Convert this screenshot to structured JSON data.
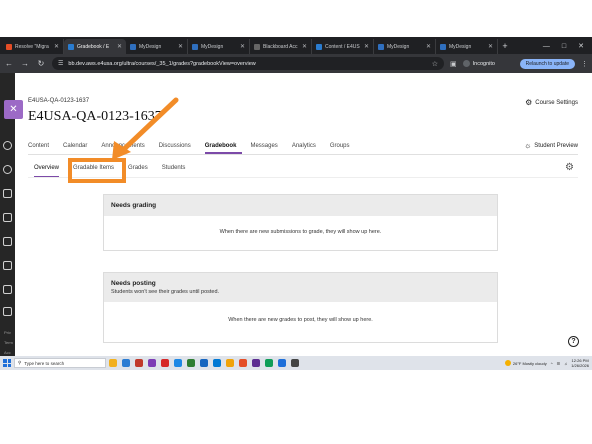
{
  "browser": {
    "tabs": [
      {
        "title": "Resolve \"Migra",
        "favicon_color": "#e44d26",
        "active": false
      },
      {
        "title": "Gradebook / E",
        "favicon_color": "#2a7ccf",
        "active": true
      },
      {
        "title": "MyDesign",
        "favicon_color": "#2f6fbf",
        "active": false
      },
      {
        "title": "MyDesign",
        "favicon_color": "#2f6fbf",
        "active": false
      },
      {
        "title": "Blackboard Acc",
        "favicon_color": "#666666",
        "active": false
      },
      {
        "title": "Content / E4US",
        "favicon_color": "#2a7ccf",
        "active": false
      },
      {
        "title": "MyDesign",
        "favicon_color": "#2f6fbf",
        "active": false
      },
      {
        "title": "MyDesign",
        "favicon_color": "#2f6fbf",
        "active": false
      }
    ],
    "new_tab": "+",
    "url": "bb.dev.aws.e4usa.org/ultra/courses/_35_1/grades?gradebookView=overview",
    "profile": "Incognito",
    "relaunch": "Relaunch to update"
  },
  "rail": {
    "labels": [
      "Priv",
      "Term",
      "Acc"
    ]
  },
  "course": {
    "breadcrumb": "E4USA-QA-0123-1637",
    "title": "E4USA-QA-0123-1637",
    "settings": "Course Settings",
    "student_preview": "Student Preview",
    "nav": [
      {
        "label": "Content",
        "active": false
      },
      {
        "label": "Calendar",
        "active": false
      },
      {
        "label": "Announcements",
        "active": false
      },
      {
        "label": "Discussions",
        "active": false
      },
      {
        "label": "Gradebook",
        "active": true
      },
      {
        "label": "Messages",
        "active": false
      },
      {
        "label": "Analytics",
        "active": false
      },
      {
        "label": "Groups",
        "active": false
      }
    ],
    "subnav": [
      {
        "label": "Overview",
        "active": true
      },
      {
        "label": "Gradable Items",
        "active": false
      },
      {
        "label": "Grades",
        "active": false
      },
      {
        "label": "Students",
        "active": false
      }
    ]
  },
  "cards": {
    "grading": {
      "heading": "Needs grading",
      "body": "When there are new submissions to grade, they will show up here."
    },
    "posting": {
      "heading": "Needs posting",
      "subtitle": "Students won't see their grades until posted.",
      "body": "When there are new grades to post, they will show up here."
    }
  },
  "annotation": {
    "color": "#f28c28"
  },
  "taskbar": {
    "search_placeholder": "Type here to search",
    "weather": "26°F  Mostly cloudy",
    "time": "12:26 PM",
    "date": "1/26/2026",
    "apps": [
      "#f2b01e",
      "#2b7cd3",
      "#c0392b",
      "#7d3cb5",
      "#d62828",
      "#1e88e5",
      "#2e7d32",
      "#1565c0",
      "#0078d4",
      "#f0a30a",
      "#e44d26",
      "#5c2d91",
      "#0f9d58",
      "#1e6fd9",
      "#444444"
    ]
  },
  "accent": "#7c4aa8"
}
